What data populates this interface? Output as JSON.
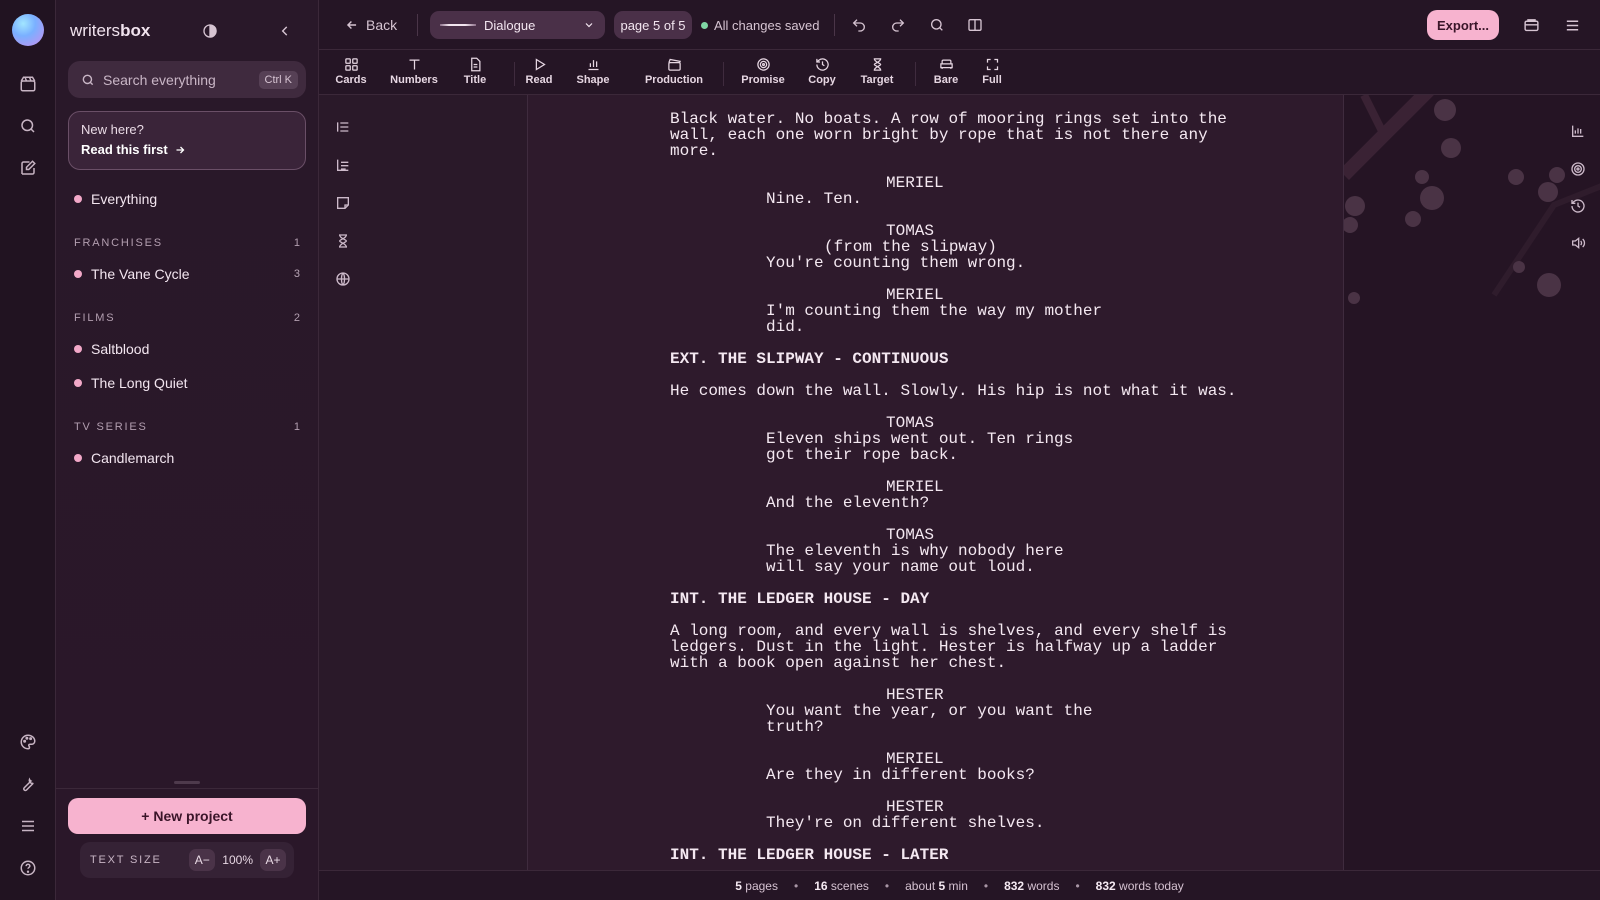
{
  "app": {
    "brand_prefix": "writers",
    "brand_suffix": "box"
  },
  "search": {
    "placeholder": "Search everything",
    "shortcut": "Ctrl K"
  },
  "onboarding": {
    "line1": "New here?",
    "line2": "Read this first"
  },
  "sidebar": {
    "everything": "Everything",
    "sections": [
      {
        "title": "FRANCHISES",
        "count": "1",
        "items": [
          {
            "label": "The Vane Cycle",
            "count": "3"
          }
        ]
      },
      {
        "title": "FILMS",
        "count": "2",
        "items": [
          {
            "label": "Saltblood",
            "count": ""
          },
          {
            "label": "The Long Quiet",
            "count": ""
          }
        ]
      },
      {
        "title": "TV SERIES",
        "count": "1",
        "items": [
          {
            "label": "Candlemarch",
            "count": ""
          }
        ]
      }
    ],
    "new_project": "+ New project",
    "text_size": {
      "label": "TEXT SIZE",
      "decrease": "A−",
      "value": "100%",
      "increase": "A+"
    }
  },
  "topbar": {
    "back": "Back",
    "element_type": "Dialogue",
    "page_indicator": "page 5 of 5",
    "save_status": "All changes saved",
    "export": "Export..."
  },
  "toolbar": {
    "tools": [
      {
        "label": "Cards",
        "icon": "cards-icon"
      },
      {
        "label": "Numbers",
        "icon": "text-icon"
      },
      {
        "label": "Title",
        "icon": "document-icon"
      },
      {
        "label": "Read",
        "icon": "play-icon"
      },
      {
        "label": "Shape",
        "icon": "chart-icon"
      },
      {
        "label": "Production",
        "icon": "clapper-icon"
      },
      {
        "label": "Promise",
        "icon": "target-icon"
      },
      {
        "label": "Copy",
        "icon": "history-icon"
      },
      {
        "label": "Target",
        "icon": "hourglass-icon"
      },
      {
        "label": "Bare",
        "icon": "couch-icon"
      },
      {
        "label": "Full",
        "icon": "fullscreen-icon"
      }
    ]
  },
  "script": [
    {
      "type": "action",
      "lines": [
        "Black water. No boats. A row of mooring rings set into the",
        "wall, each one worn bright by rope that is not there any",
        "more."
      ]
    },
    {
      "type": "character",
      "lines": [
        "MERIEL"
      ]
    },
    {
      "type": "dialogue",
      "lines": [
        "Nine. Ten."
      ]
    },
    {
      "type": "character",
      "lines": [
        "TOMAS"
      ]
    },
    {
      "type": "parenthetical",
      "lines": [
        "(from the slipway)"
      ]
    },
    {
      "type": "dialogue",
      "lines": [
        "You're counting them wrong."
      ]
    },
    {
      "type": "character",
      "lines": [
        "MERIEL"
      ]
    },
    {
      "type": "dialogue",
      "lines": [
        "I'm counting them the way my mother",
        "did."
      ]
    },
    {
      "type": "scene",
      "lines": [
        "EXT. THE SLIPWAY - CONTINUOUS"
      ]
    },
    {
      "type": "action",
      "lines": [
        "He comes down the wall. Slowly. His hip is not what it was."
      ]
    },
    {
      "type": "character",
      "lines": [
        "TOMAS"
      ]
    },
    {
      "type": "dialogue",
      "lines": [
        "Eleven ships went out. Ten rings",
        "got their rope back."
      ]
    },
    {
      "type": "character",
      "lines": [
        "MERIEL"
      ]
    },
    {
      "type": "dialogue",
      "lines": [
        "And the eleventh?"
      ]
    },
    {
      "type": "character",
      "lines": [
        "TOMAS"
      ]
    },
    {
      "type": "dialogue",
      "lines": [
        "The eleventh is why nobody here",
        "will say your name out loud."
      ]
    },
    {
      "type": "scene",
      "lines": [
        "INT. THE LEDGER HOUSE - DAY"
      ]
    },
    {
      "type": "action",
      "lines": [
        "A long room, and every wall is shelves, and every shelf is",
        "ledgers. Dust in the light. Hester is halfway up a ladder",
        "with a book open against her chest."
      ]
    },
    {
      "type": "character",
      "lines": [
        "HESTER"
      ]
    },
    {
      "type": "dialogue",
      "lines": [
        "You want the year, or you want the",
        "truth?"
      ]
    },
    {
      "type": "character",
      "lines": [
        "MERIEL"
      ]
    },
    {
      "type": "dialogue",
      "lines": [
        "Are they in different books?"
      ]
    },
    {
      "type": "character",
      "lines": [
        "HESTER"
      ]
    },
    {
      "type": "dialogue",
      "lines": [
        "They're on different shelves."
      ]
    },
    {
      "type": "scene",
      "lines": [
        "INT. THE LEDGER HOUSE - LATER"
      ]
    }
  ],
  "status": {
    "pages": "5",
    "pages_label": "pages",
    "scenes": "16",
    "scenes_label": "scenes",
    "time_prefix": "about",
    "time_value": "5",
    "time_unit": "min",
    "words": "832",
    "words_label": "words",
    "words_today": "832",
    "words_today_label": "words today"
  },
  "colors": {
    "accent": "#f7b3cf",
    "saved_dot": "#7fd6a4",
    "background": "#251525"
  }
}
